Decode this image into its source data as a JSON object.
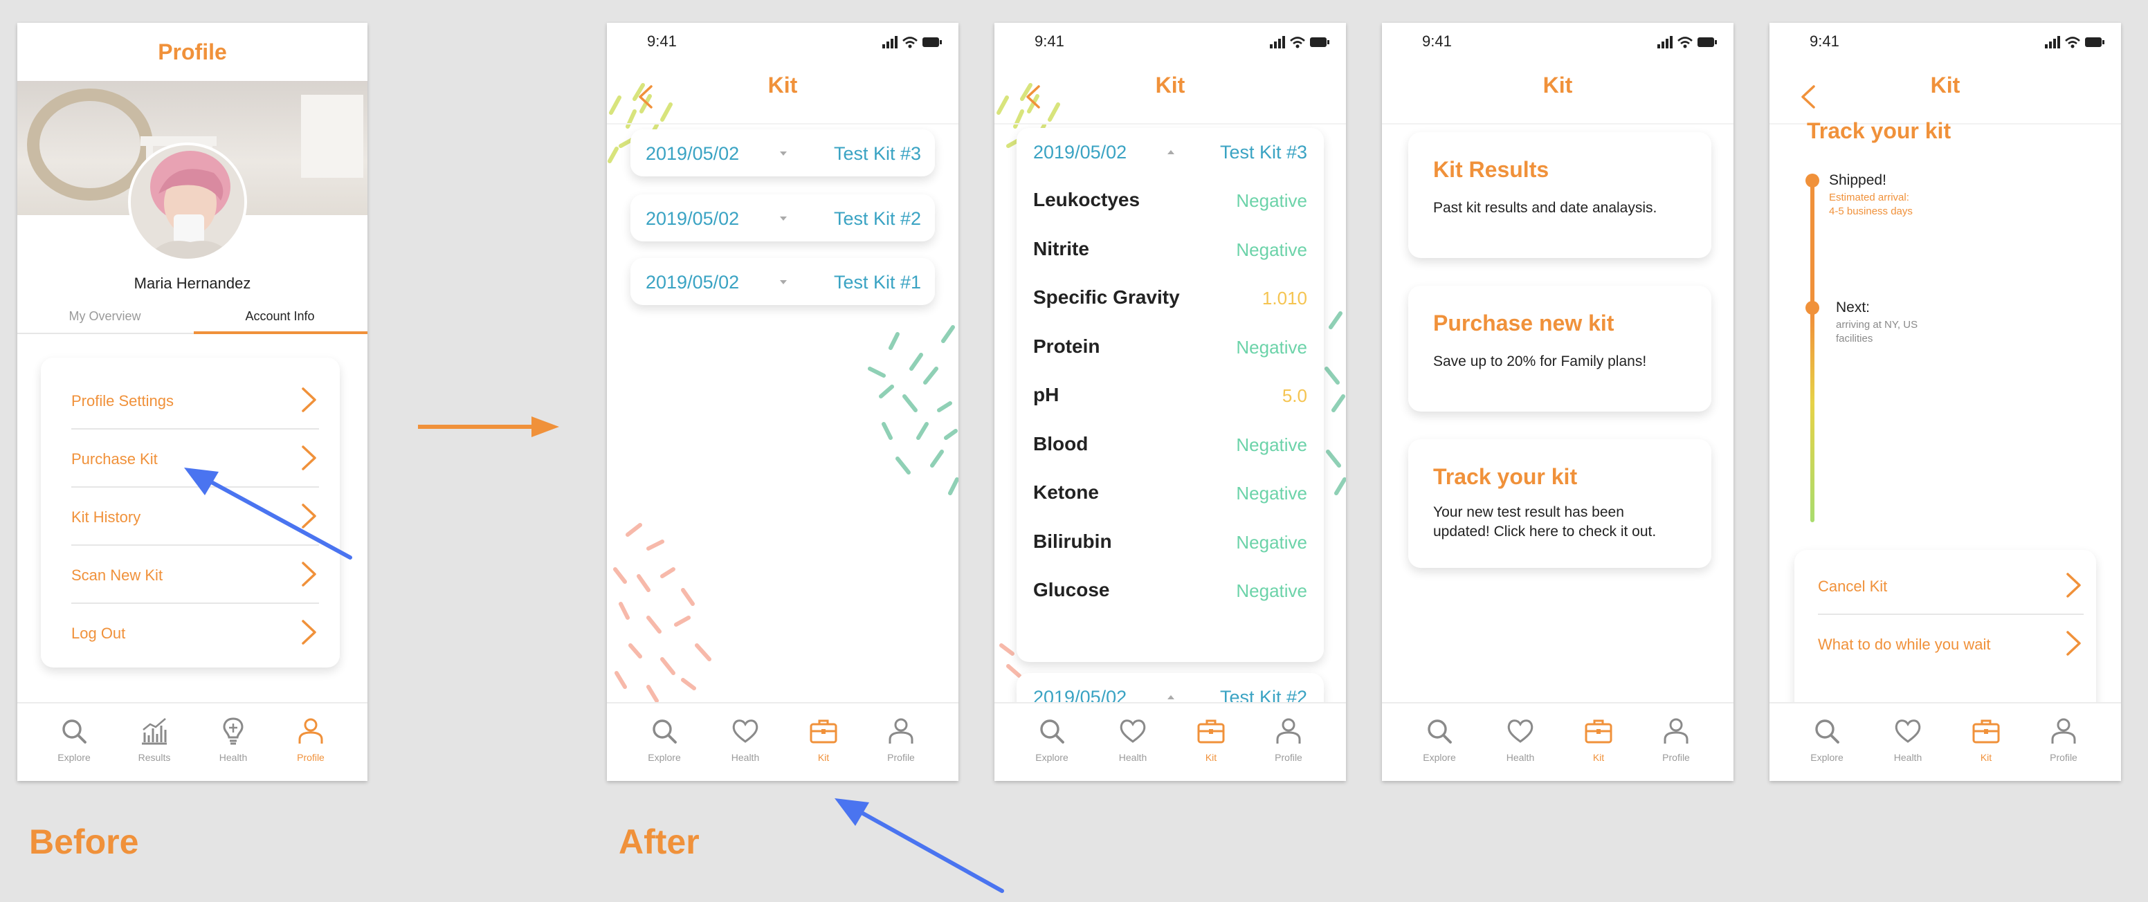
{
  "captions": {
    "before": "Before",
    "after": "After"
  },
  "profile_screen": {
    "title": "Profile",
    "user_name": "Maria Hernandez",
    "tabs": {
      "overview": "My Overview",
      "account": "Account Info"
    },
    "menu": [
      "Profile Settings",
      "Purchase Kit",
      "Kit History",
      "Scan New Kit",
      "Log Out"
    ],
    "tabbar": [
      "Explore",
      "Results",
      "Health",
      "Profile"
    ]
  },
  "status_time": "9:41",
  "kit_title": "Kit",
  "kit_tabbar": [
    "Explore",
    "Health",
    "Kit",
    "Profile"
  ],
  "kit_list_screen": {
    "rows": [
      {
        "date": "2019/05/02",
        "kit": "Test Kit #3"
      },
      {
        "date": "2019/05/02",
        "kit": "Test Kit #2"
      },
      {
        "date": "2019/05/02",
        "kit": "Test Kit #1"
      }
    ]
  },
  "kit_results_screen": {
    "header": {
      "date": "2019/05/02",
      "kit": "Test Kit #3"
    },
    "results": [
      {
        "name": "Leukoctyes",
        "value": "Negative",
        "status": "normal"
      },
      {
        "name": "Nitrite",
        "value": "Negative",
        "status": "normal"
      },
      {
        "name": "Specific Gravity",
        "value": "1.010",
        "status": "warn"
      },
      {
        "name": "Protein",
        "value": "Negative",
        "status": "normal"
      },
      {
        "name": "pH",
        "value": "5.0",
        "status": "warn"
      },
      {
        "name": "Blood",
        "value": "Negative",
        "status": "normal"
      },
      {
        "name": "Ketone",
        "value": "Negative",
        "status": "normal"
      },
      {
        "name": "Bilirubin",
        "value": "Negative",
        "status": "normal"
      },
      {
        "name": "Glucose",
        "value": "Negative",
        "status": "normal"
      }
    ],
    "next": {
      "date": "2019/05/02",
      "kit": "Test Kit #2"
    }
  },
  "kit_home_screen": {
    "cards": [
      {
        "title": "Kit Results",
        "body": "Past kit results and date analaysis."
      },
      {
        "title": "Purchase new kit",
        "body": "Save up to 20% for Family plans!"
      },
      {
        "title": "Track your kit",
        "body": "Your new test result has been updated! Click here to check it out."
      }
    ]
  },
  "track_screen": {
    "heading": "Track your kit",
    "steps": [
      {
        "label": "Shipped!",
        "detail_1": "Estimated arrival:",
        "detail_2": "4-5 business days"
      },
      {
        "label": "Next:",
        "detail_1": "arriving at NY, US",
        "detail_2": "facilities"
      }
    ],
    "actions": [
      "Cancel Kit",
      "What to do while you wait"
    ]
  },
  "colors": {
    "accent": "#f0913a",
    "teal": "#3aa3c3",
    "green": "#6cd3a9",
    "yellow": "#f5c451",
    "arrow": "#4a74f0"
  }
}
